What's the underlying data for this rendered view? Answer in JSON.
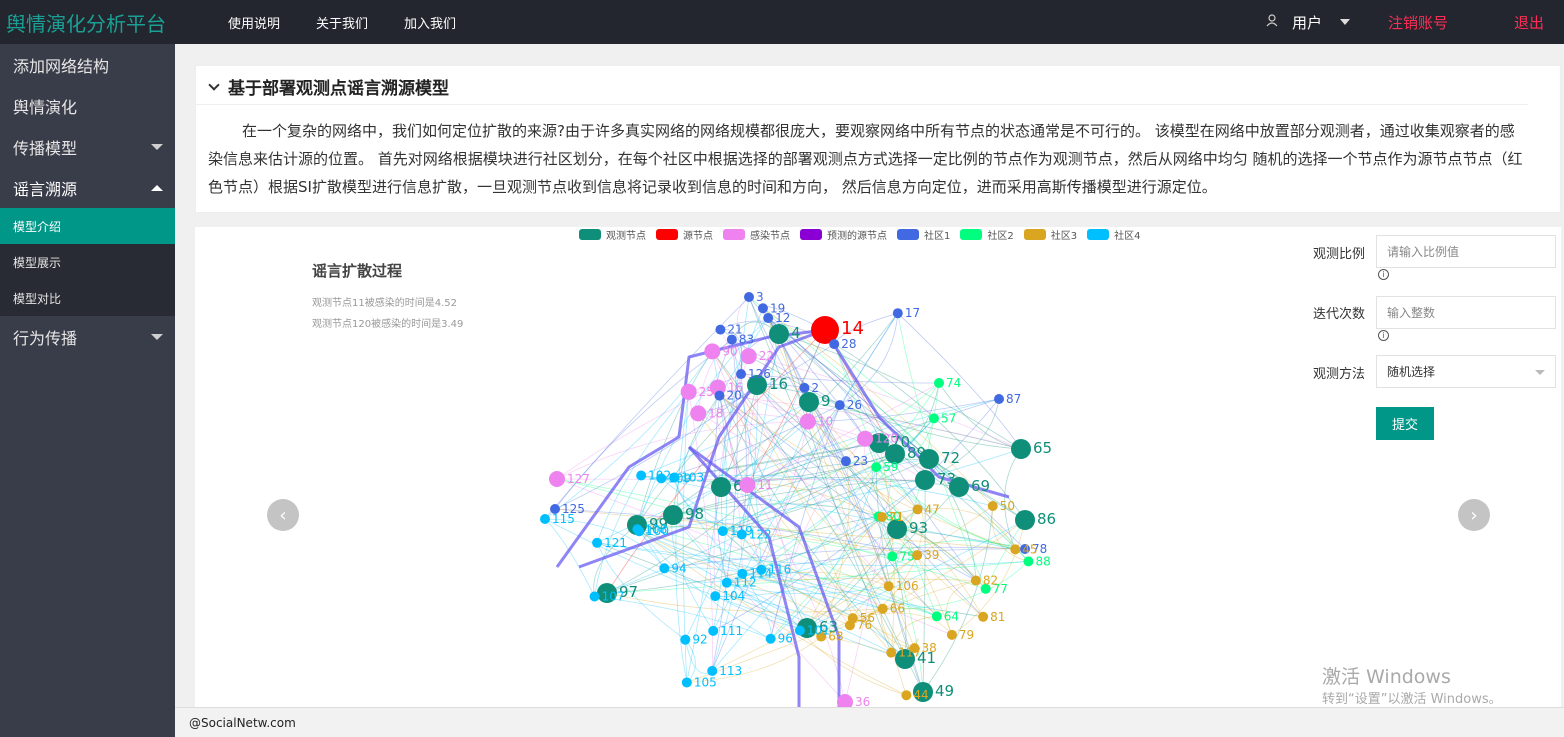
{
  "topbar": {
    "brand": "舆情演化分析平台",
    "nav": [
      "使用说明",
      "关于我们",
      "加入我们"
    ],
    "user_label": "用户",
    "logout_account": "注销账号",
    "exit": "退出"
  },
  "sidebar": {
    "items": [
      {
        "label": "添加网络结构",
        "has_caret": false
      },
      {
        "label": "舆情演化",
        "has_caret": false
      },
      {
        "label": "传播模型",
        "has_caret": true
      },
      {
        "label": "谣言溯源",
        "has_caret": true,
        "expanded": true
      },
      {
        "label": "行为传播",
        "has_caret": true
      }
    ],
    "sub_items": [
      {
        "label": "模型介绍",
        "selected": true
      },
      {
        "label": "模型展示",
        "selected": false
      },
      {
        "label": "模型对比",
        "selected": false
      }
    ]
  },
  "card": {
    "title": "基于部署观测点谣言溯源模型",
    "description": "在一个复杂的网络中，我们如何定位扩散的来源?由于许多真实网络的网络规模都很庞大，要观察网络中所有节点的状态通常是不可行的。 该模型在网络中放置部分观测者，通过收集观察者的感染信息来估计源的位置。 首先对网络根据模块进行社区划分，在每个社区中根据选择的部署观测点方式选择一定比例的节点作为观测节点，然后从网络中均匀 随机的选择一个节点作为源节点节点（红色节点）根据SI扩散模型进行信息扩散，一旦观测节点收到信息将记录收到信息的时间和方向， 然后信息方向定位，进而采用高斯传播模型进行源定位。"
  },
  "graph": {
    "title": "谣言扩散过程",
    "notes": [
      "观测节点11被感染的时间是4.52",
      "观测节点120被感染的时间是3.49"
    ],
    "legend": [
      {
        "label": "观测节点",
        "color": "#0f8f7a"
      },
      {
        "label": "源节点",
        "color": "#ff0000"
      },
      {
        "label": "感染节点",
        "color": "#ee82ee"
      },
      {
        "label": "预测的源节点",
        "color": "#8a00d4"
      },
      {
        "label": "社区1",
        "color": "#4169e1"
      },
      {
        "label": "社区2",
        "color": "#00ff7f"
      },
      {
        "label": "社区3",
        "color": "#daa520"
      },
      {
        "label": "社区4",
        "color": "#00bfff"
      }
    ],
    "nodes": [
      {
        "id": "14",
        "type": "source"
      },
      {
        "id": "4",
        "type": "observer"
      },
      {
        "id": "16",
        "type": "observer"
      },
      {
        "id": "6",
        "type": "observer"
      },
      {
        "id": "70",
        "type": "observer"
      },
      {
        "id": "89",
        "type": "observer"
      },
      {
        "id": "72",
        "type": "observer"
      },
      {
        "id": "65",
        "type": "observer"
      },
      {
        "id": "73",
        "type": "observer"
      },
      {
        "id": "69",
        "type": "observer"
      },
      {
        "id": "86",
        "type": "observer"
      },
      {
        "id": "93",
        "type": "observer"
      },
      {
        "id": "98",
        "type": "observer"
      },
      {
        "id": "99",
        "type": "observer"
      },
      {
        "id": "97",
        "type": "observer"
      },
      {
        "id": "63",
        "type": "observer"
      },
      {
        "id": "41",
        "type": "observer"
      },
      {
        "id": "49",
        "type": "observer"
      },
      {
        "id": "9",
        "type": "observer"
      },
      {
        "id": "25",
        "type": "infected"
      },
      {
        "id": "10",
        "type": "infected"
      },
      {
        "id": "18",
        "type": "infected"
      },
      {
        "id": "127",
        "type": "infected"
      },
      {
        "id": "120",
        "type": "infected"
      },
      {
        "id": "90",
        "type": "infected"
      },
      {
        "id": "36",
        "type": "infected"
      },
      {
        "id": "11",
        "type": "infected"
      },
      {
        "id": "22",
        "type": "infected"
      },
      {
        "id": "16b",
        "type": "infected"
      },
      {
        "id": "3",
        "type": "c1"
      },
      {
        "id": "12",
        "type": "c1"
      },
      {
        "id": "21",
        "type": "c1"
      },
      {
        "id": "2",
        "type": "c1"
      },
      {
        "id": "17",
        "type": "c1"
      },
      {
        "id": "26",
        "type": "c1"
      },
      {
        "id": "28",
        "type": "c1"
      },
      {
        "id": "20",
        "type": "c1"
      },
      {
        "id": "19",
        "type": "c1"
      },
      {
        "id": "23",
        "type": "c1"
      },
      {
        "id": "125",
        "type": "c1"
      },
      {
        "id": "126",
        "type": "c1"
      },
      {
        "id": "87",
        "type": "c1"
      },
      {
        "id": "83",
        "type": "c1"
      },
      {
        "id": "78",
        "type": "c1"
      },
      {
        "id": "74",
        "type": "c2"
      },
      {
        "id": "77",
        "type": "c2"
      },
      {
        "id": "75",
        "type": "c2"
      },
      {
        "id": "88",
        "type": "c2"
      },
      {
        "id": "64",
        "type": "c2"
      },
      {
        "id": "80",
        "type": "c2"
      },
      {
        "id": "59",
        "type": "c2"
      },
      {
        "id": "57",
        "type": "c2"
      },
      {
        "id": "79",
        "type": "c3"
      },
      {
        "id": "66",
        "type": "c3"
      },
      {
        "id": "81",
        "type": "c3"
      },
      {
        "id": "71",
        "type": "c3"
      },
      {
        "id": "82",
        "type": "c3"
      },
      {
        "id": "76",
        "type": "c3"
      },
      {
        "id": "68",
        "type": "c3"
      },
      {
        "id": "56",
        "type": "c3"
      },
      {
        "id": "38",
        "type": "c3"
      },
      {
        "id": "39",
        "type": "c3"
      },
      {
        "id": "44",
        "type": "c3"
      },
      {
        "id": "50",
        "type": "c3"
      },
      {
        "id": "45",
        "type": "c3"
      },
      {
        "id": "47",
        "type": "c3"
      },
      {
        "id": "106",
        "type": "c3"
      },
      {
        "id": "117",
        "type": "c3"
      },
      {
        "id": "111",
        "type": "c4"
      },
      {
        "id": "115",
        "type": "c4"
      },
      {
        "id": "109",
        "type": "c4"
      },
      {
        "id": "105",
        "type": "c4"
      },
      {
        "id": "116",
        "type": "c4"
      },
      {
        "id": "100",
        "type": "c4"
      },
      {
        "id": "101",
        "type": "c4"
      },
      {
        "id": "107",
        "type": "c4"
      },
      {
        "id": "108",
        "type": "c4"
      },
      {
        "id": "96",
        "type": "c4"
      },
      {
        "id": "122",
        "type": "c4"
      },
      {
        "id": "114",
        "type": "c4"
      },
      {
        "id": "103",
        "type": "c4"
      },
      {
        "id": "102",
        "type": "c4"
      },
      {
        "id": "113",
        "type": "c4"
      },
      {
        "id": "104",
        "type": "c4"
      },
      {
        "id": "112",
        "type": "c4"
      },
      {
        "id": "121",
        "type": "c4"
      },
      {
        "id": "119",
        "type": "c4"
      },
      {
        "id": "94",
        "type": "c4"
      },
      {
        "id": "92",
        "type": "c4"
      }
    ]
  },
  "form": {
    "ratio_label": "观测比例",
    "ratio_placeholder": "请输入比例值",
    "iter_label": "迭代次数",
    "iter_placeholder": "输入整数",
    "method_label": "观测方法",
    "method_value": "随机选择",
    "submit": "提交"
  },
  "carousel": {
    "prev": "‹",
    "next": "›"
  },
  "watermark": {
    "line1": "激活 Windows",
    "line2": "转到“设置”以激活 Windows。"
  },
  "footer": {
    "text": "@SocialNetw.com"
  },
  "colors": {
    "accent": "#009688",
    "topbar": "#23262e",
    "sidebar": "#393d49",
    "danger": "#ff2d55"
  }
}
